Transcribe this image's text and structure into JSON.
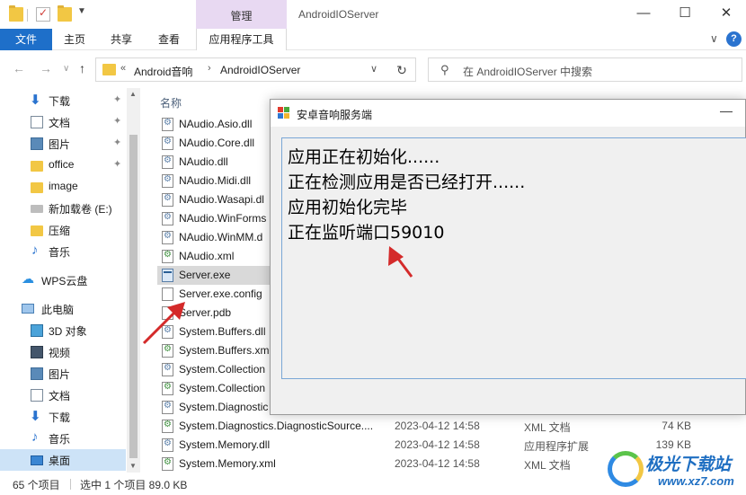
{
  "titlebar": {
    "context_tab": "管理",
    "window_title": "AndroidIOServer",
    "controls": {
      "minimize": "—",
      "maximize": "☐",
      "close": "✕"
    }
  },
  "ribbon": {
    "file_tab": "文件",
    "tabs": [
      "主页",
      "共享",
      "查看",
      "应用程序工具"
    ],
    "collapse": "∨",
    "help": "?"
  },
  "navbar": {
    "back": "←",
    "forward": "→",
    "recent": "∨",
    "up": "↑",
    "breadcrumb_prefix": "«",
    "breadcrumb": [
      "Android音响",
      "AndroidIOServer"
    ],
    "dropdown": "∨",
    "refresh": "↻",
    "search_placeholder": "在 AndroidIOServer 中搜索"
  },
  "sidebar": {
    "quick_access": [
      {
        "label": "下载",
        "icon": "download-icon",
        "pinned": true
      },
      {
        "label": "文档",
        "icon": "document-icon",
        "pinned": true
      },
      {
        "label": "图片",
        "icon": "picture-icon",
        "pinned": true
      },
      {
        "label": "office",
        "icon": "folder-icon",
        "pinned": true
      },
      {
        "label": "image",
        "icon": "folder-icon",
        "pinned": false
      },
      {
        "label": "新加载卷 (E:)",
        "icon": "drive-icon",
        "pinned": false
      },
      {
        "label": "压缩",
        "icon": "folder-icon",
        "pinned": false
      },
      {
        "label": "音乐",
        "icon": "music-icon",
        "pinned": false
      }
    ],
    "cloud": {
      "label": "WPS云盘",
      "icon": "cloud-icon"
    },
    "this_pc": {
      "label": "此电脑",
      "icon": "computer-icon"
    },
    "pc_items": [
      {
        "label": "3D 对象",
        "icon": "3d-objects-icon"
      },
      {
        "label": "视频",
        "icon": "video-icon"
      },
      {
        "label": "图片",
        "icon": "picture-icon"
      },
      {
        "label": "文档",
        "icon": "document-icon"
      },
      {
        "label": "下载",
        "icon": "download-icon"
      },
      {
        "label": "音乐",
        "icon": "music-icon"
      },
      {
        "label": "桌面",
        "icon": "desktop-icon"
      }
    ],
    "pin_glyph": "📌"
  },
  "filelist": {
    "column_name": "名称",
    "files": [
      {
        "name": "NAudio.Asio.dll",
        "date": "",
        "type": "",
        "size": "",
        "icon": "gear"
      },
      {
        "name": "NAudio.Core.dll",
        "date": "",
        "type": "",
        "size": "",
        "icon": "gear"
      },
      {
        "name": "NAudio.dll",
        "date": "",
        "type": "",
        "size": "",
        "icon": "gear"
      },
      {
        "name": "NAudio.Midi.dll",
        "date": "",
        "type": "",
        "size": "",
        "icon": "gear"
      },
      {
        "name": "NAudio.Wasapi.dl",
        "date": "",
        "type": "",
        "size": "",
        "icon": "gear"
      },
      {
        "name": "NAudio.WinForms",
        "date": "",
        "type": "",
        "size": "",
        "icon": "gear"
      },
      {
        "name": "NAudio.WinMM.d",
        "date": "",
        "type": "",
        "size": "",
        "icon": "gear"
      },
      {
        "name": "NAudio.xml",
        "date": "",
        "type": "",
        "size": "",
        "icon": "xml"
      },
      {
        "name": "Server.exe",
        "date": "",
        "type": "",
        "size": "",
        "icon": "exe"
      },
      {
        "name": "Server.exe.config",
        "date": "",
        "type": "",
        "size": "",
        "icon": "blank"
      },
      {
        "name": "Server.pdb",
        "date": "",
        "type": "",
        "size": "",
        "icon": "blank"
      },
      {
        "name": "System.Buffers.dll",
        "date": "",
        "type": "",
        "size": "",
        "icon": "gear"
      },
      {
        "name": "System.Buffers.xm",
        "date": "",
        "type": "",
        "size": "",
        "icon": "xml"
      },
      {
        "name": "System.Collection",
        "date": "",
        "type": "",
        "size": "",
        "icon": "gear"
      },
      {
        "name": "System.Collection",
        "date": "",
        "type": "",
        "size": "",
        "icon": "xml"
      },
      {
        "name": "System.Diagnostic",
        "date": "",
        "type": "",
        "size": "",
        "icon": "gear"
      },
      {
        "name": "System.Diagnostics.DiagnosticSource....",
        "date": "2023-04-12 14:58",
        "type": "XML 文档",
        "size": "74 KB",
        "icon": "xml"
      },
      {
        "name": "System.Memory.dll",
        "date": "2023-04-12 14:58",
        "type": "应用程序扩展",
        "size": "139 KB",
        "icon": "gear"
      },
      {
        "name": "System.Memory.xml",
        "date": "2023-04-12 14:58",
        "type": "XML 文档",
        "size": "",
        "icon": "xml"
      }
    ]
  },
  "statusbar": {
    "item_count": "65 个项目",
    "selection": "选中 1 个项目  89.0 KB"
  },
  "watermark": {
    "text": "极光下载站",
    "url": "www.xz7.com"
  },
  "dialog": {
    "title": "安卓音响服务端",
    "minimize": "—",
    "log_lines": [
      "应用正在初始化......",
      "正在检测应用是否已经打开......",
      "应用初始化完毕",
      "正在监听端口59010"
    ]
  },
  "colors": {
    "file_tab": "#1e6fc9",
    "context_tab": "#e8d9f2",
    "selection": "#cde3f7",
    "arrow": "#d42a2a"
  }
}
